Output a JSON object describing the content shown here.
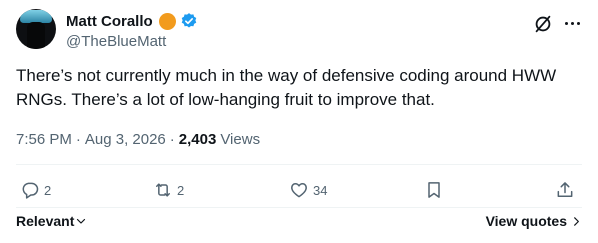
{
  "author": {
    "display_name": "Matt Corallo",
    "handle": "@TheBlueMatt"
  },
  "tweet": {
    "text": "There’s not currently much in the way of defensive coding around HWW RNGs. There’s a lot of low-hanging fruit to improve that.",
    "time": "7:56 PM",
    "date": "Aug 3, 2026",
    "separator": "·",
    "view_count": "2,403",
    "views_label": "Views"
  },
  "actions": {
    "replies": "2",
    "reposts": "2",
    "likes": "34"
  },
  "footer": {
    "sort_label": "Relevant",
    "view_quotes": "View quotes"
  },
  "colors": {
    "text": "#0f1419",
    "secondary": "#536471",
    "verified": "#1d9bf0",
    "gold_badge": "#f29b1d",
    "divider": "#eff3f4"
  },
  "icons": [
    "grok-icon",
    "more-icon",
    "reply-icon",
    "repost-icon",
    "like-icon",
    "bookmark-icon",
    "share-icon",
    "chevron-down-icon",
    "chevron-right-icon",
    "verified-badge-icon"
  ]
}
